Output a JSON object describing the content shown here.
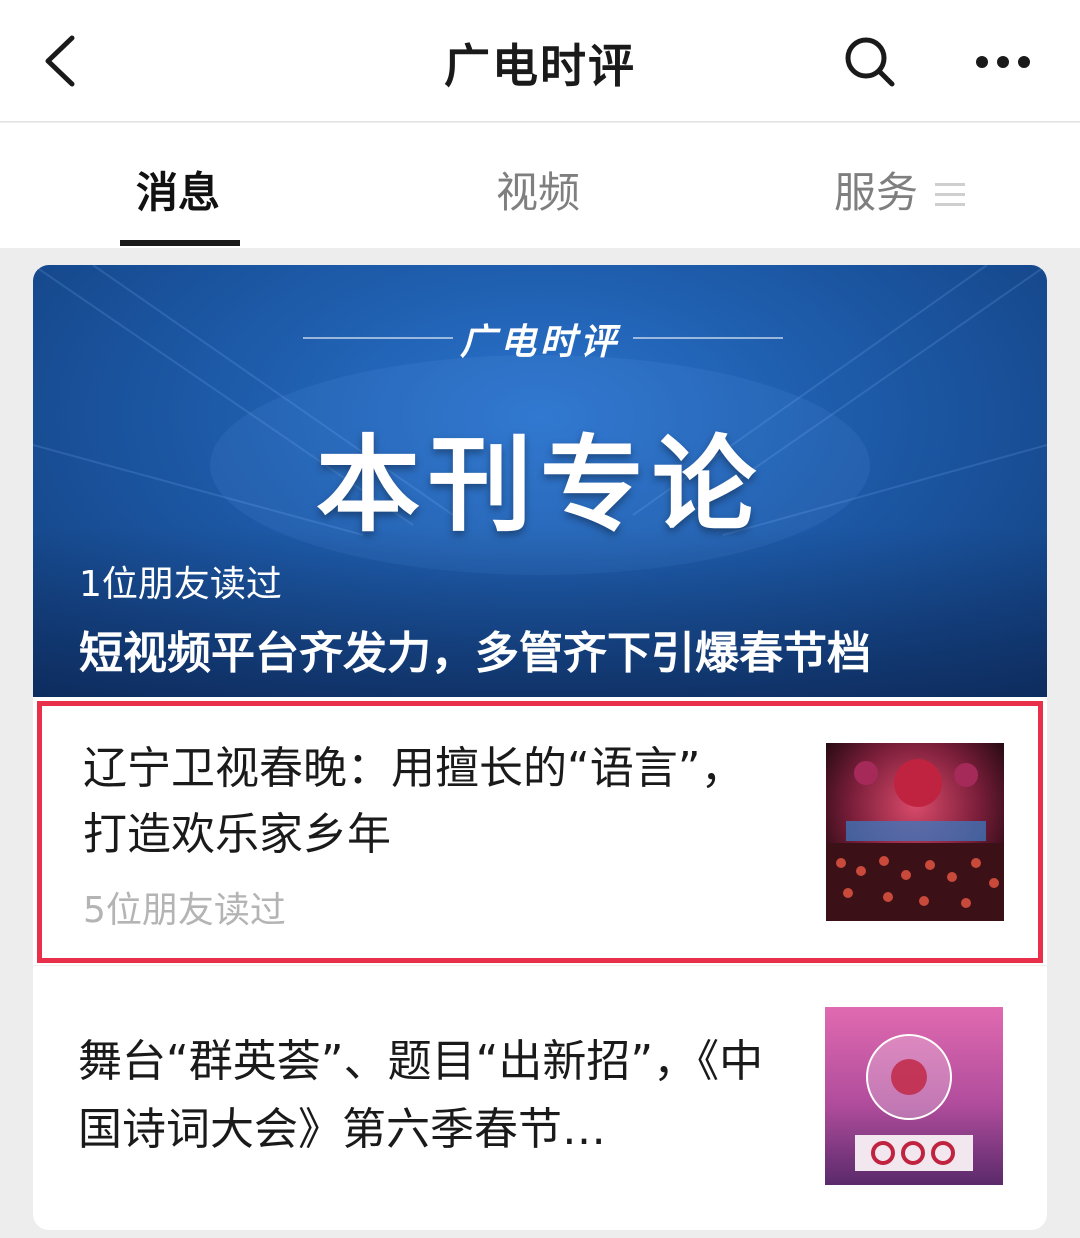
{
  "header": {
    "title": "广电时评",
    "back_icon": "chevron-left-icon",
    "search_icon": "search-icon",
    "more_icon": "more-dots-icon"
  },
  "tabs": [
    {
      "label": "消息",
      "active": true
    },
    {
      "label": "视频",
      "active": false
    },
    {
      "label": "服务",
      "active": false
    }
  ],
  "banner": {
    "brand": "广电时评",
    "headline": "本刊专论",
    "readers": "1位朋友读过",
    "title": "短视频平台齐发力，多管齐下引爆春节档"
  },
  "articles": [
    {
      "title": "辽宁卫视春晚：用擅长的“语言”，打造欢乐家乡年",
      "readers": "5位朋友读过",
      "highlighted": true,
      "highlight_color": "#e8304a"
    },
    {
      "title": "舞台“群英荟”、题目“出新招”，《中国诗词大会》第六季春节…"
    }
  ]
}
